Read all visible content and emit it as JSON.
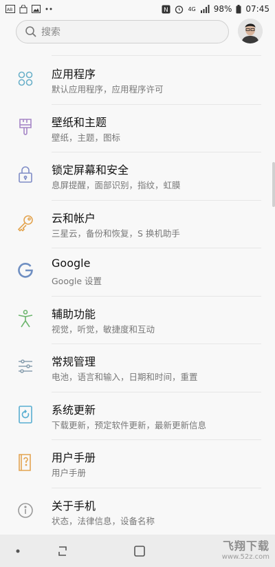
{
  "status_bar": {
    "icons_left": [
      "gallery-icon",
      "bag-icon",
      "image-icon",
      "more-dots-icon"
    ],
    "nfc": "N",
    "network": "4G",
    "battery": "98%",
    "time": "07:45"
  },
  "search": {
    "placeholder": "搜索"
  },
  "settings": [
    {
      "title": "应用程序",
      "subtitle": "默认应用程序，应用程序许可",
      "icon": "apps-grid-icon",
      "color": "#6ab0c9"
    },
    {
      "title": "壁纸和主题",
      "subtitle": "壁纸，主题，图标",
      "icon": "brush-icon",
      "color": "#a585c6"
    },
    {
      "title": "锁定屏幕和安全",
      "subtitle": "息屏提醒，面部识别，指纹，虹膜",
      "icon": "lock-icon",
      "color": "#7f8cc6"
    },
    {
      "title": "云和帐户",
      "subtitle": "三星云，备份和恢复，S 换机助手",
      "icon": "key-icon",
      "color": "#e3a450"
    },
    {
      "title": "Google",
      "subtitle": "Google 设置",
      "icon": "google-icon",
      "color": "#6f8fc2"
    },
    {
      "title": "辅助功能",
      "subtitle": "视觉，听觉，敏捷度和互动",
      "icon": "accessibility-icon",
      "color": "#6cb56d"
    },
    {
      "title": "常规管理",
      "subtitle": "电池，语言和输入，日期和时间，重置",
      "icon": "sliders-icon",
      "color": "#8aa0b0"
    },
    {
      "title": "系统更新",
      "subtitle": "下载更新，预定软件更新，最新更新信息",
      "icon": "update-icon",
      "color": "#58aed1"
    },
    {
      "title": "用户手册",
      "subtitle": "用户手册",
      "icon": "manual-icon",
      "color": "#e3a450"
    },
    {
      "title": "关于手机",
      "subtitle": "状态，法律信息，设备名称",
      "icon": "info-icon",
      "color": "#9a9a9a"
    }
  ],
  "watermark": {
    "title": "飞翔下载",
    "url": "www.52z.com"
  }
}
